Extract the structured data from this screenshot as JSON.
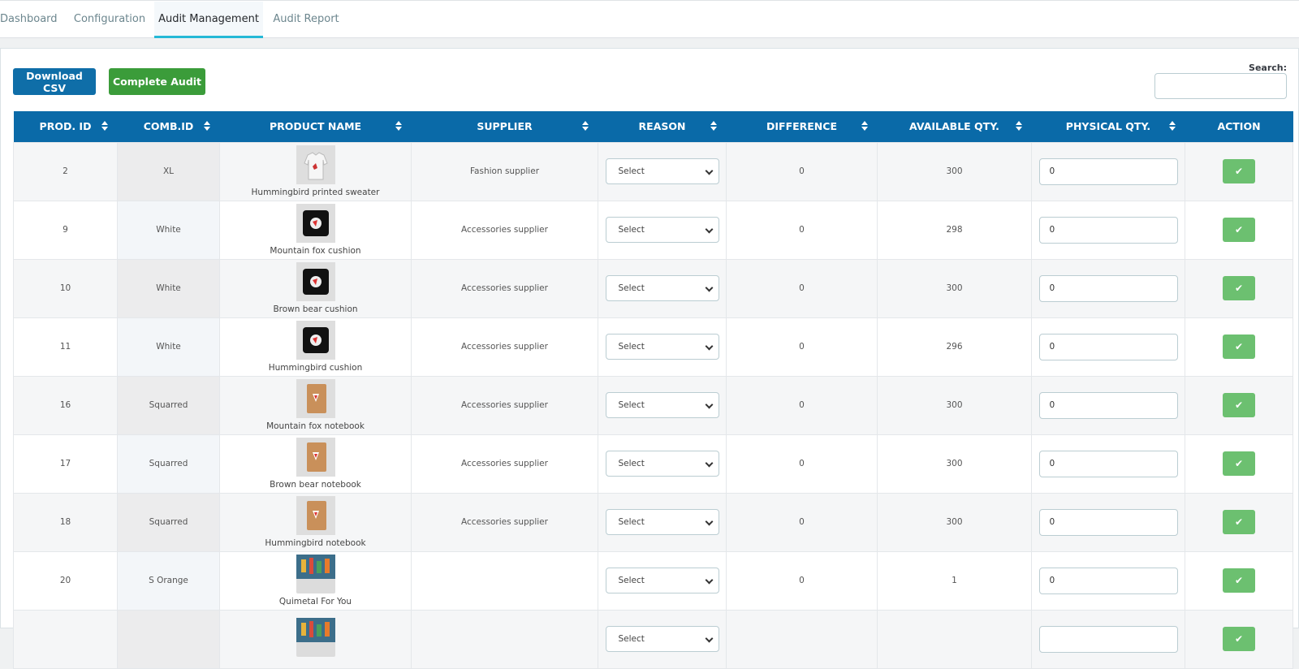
{
  "tabs": [
    "Dashboard",
    "Configuration",
    "Audit Management",
    "Audit Report"
  ],
  "active_tab": 2,
  "toolbar": {
    "download_label": "Download CSV",
    "complete_label": "Complete Audit"
  },
  "search": {
    "label": "Search:",
    "value": ""
  },
  "columns": [
    "PROD. ID",
    "COMB.ID",
    "PRODUCT NAME",
    "SUPPLIER",
    "REASON",
    "DIFFERENCE",
    "AVAILABLE QTY.",
    "PHYSICAL QTY.",
    "ACTION"
  ],
  "rows": [
    {
      "id": "2",
      "comb": "XL",
      "name": "Hummingbird printed sweater",
      "image": "sweater-image",
      "supplier": "Fashion supplier",
      "reason": "Select",
      "difference": "0",
      "available": "300",
      "physical": "0"
    },
    {
      "id": "9",
      "comb": "White",
      "name": "Mountain fox cushion",
      "image": "cushion-image",
      "supplier": "Accessories supplier",
      "reason": "Select",
      "difference": "0",
      "available": "298",
      "physical": "0"
    },
    {
      "id": "10",
      "comb": "White",
      "name": "Brown bear cushion",
      "image": "cushion-image",
      "supplier": "Accessories supplier",
      "reason": "Select",
      "difference": "0",
      "available": "300",
      "physical": "0"
    },
    {
      "id": "11",
      "comb": "White",
      "name": "Hummingbird cushion",
      "image": "cushion-image",
      "supplier": "Accessories supplier",
      "reason": "Select",
      "difference": "0",
      "available": "296",
      "physical": "0"
    },
    {
      "id": "16",
      "comb": "Squarred",
      "name": "Mountain fox notebook",
      "image": "notebook-image",
      "supplier": "Accessories supplier",
      "reason": "Select",
      "difference": "0",
      "available": "300",
      "physical": "0"
    },
    {
      "id": "17",
      "comb": "Squarred",
      "name": "Brown bear notebook",
      "image": "notebook-image",
      "supplier": "Accessories supplier",
      "reason": "Select",
      "difference": "0",
      "available": "300",
      "physical": "0"
    },
    {
      "id": "18",
      "comb": "Squarred",
      "name": "Hummingbird notebook",
      "image": "notebook-image",
      "supplier": "Accessories supplier",
      "reason": "Select",
      "difference": "0",
      "available": "300",
      "physical": "0"
    },
    {
      "id": "20",
      "comb": "S Orange",
      "name": "Quimetal For You",
      "image": "poster-image",
      "supplier": "",
      "reason": "Select",
      "difference": "0",
      "available": "1",
      "physical": "0"
    },
    {
      "id": "",
      "comb": "",
      "name": "",
      "image": "poster-image",
      "supplier": "",
      "reason": "Select",
      "difference": "",
      "available": "",
      "physical": ""
    }
  ],
  "colors": {
    "header_blue": "#0a6aa8",
    "download_blue": "#0f6ea8",
    "complete_green": "#3b9c3a",
    "action_green": "#6cc070",
    "tab_accent": "#25b9d7"
  }
}
